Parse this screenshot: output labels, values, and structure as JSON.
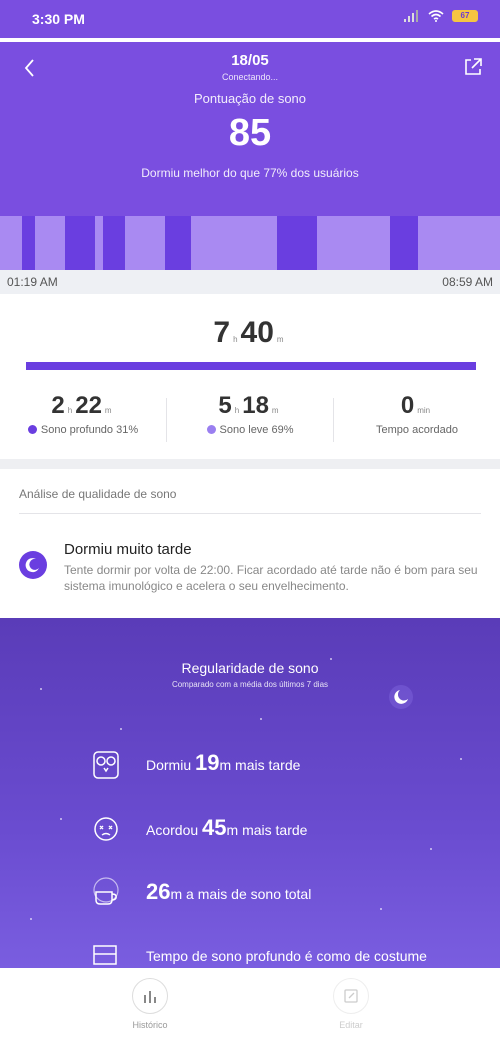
{
  "status_bar": {
    "time": "3:30 PM",
    "battery": "67"
  },
  "header": {
    "date": "18/05",
    "connecting": "Conectando...",
    "score_label": "Pontuação de sono",
    "score": "85",
    "score_desc": "Dormiu melhor do que 77% dos usuários"
  },
  "timeline": {
    "start": "01:19 AM",
    "end": "08:59 AM"
  },
  "total": {
    "hours": "7",
    "hours_unit": "h",
    "minutes": "40",
    "minutes_unit": "m"
  },
  "stats": [
    {
      "hours": "2",
      "h_unit": "h",
      "minutes": "22",
      "m_unit": "m",
      "label": "Sono profundo 31%",
      "color": "#6a3ee0"
    },
    {
      "hours": "5",
      "h_unit": "h",
      "minutes": "18",
      "m_unit": "m",
      "label": "Sono leve 69%",
      "color": "#9a7ff0"
    },
    {
      "minutes": "0",
      "m_unit": "min",
      "label": "Tempo acordado"
    }
  ],
  "analysis": {
    "label": "Análise de qualidade de sono",
    "tip_title": "Dormiu muito tarde",
    "tip_text": "Tente dormir por volta de 22:00. Ficar acordado até tarde não é bom para seu sistema imunológico e acelera o seu envelhecimento."
  },
  "regularity": {
    "title": "Regularidade de sono",
    "subtitle": "Comparado com a média dos últimos 7 dias",
    "rows": [
      {
        "prefix": "Dormiu ",
        "value": "19",
        "suffix": "m mais tarde",
        "icon": "owl-icon"
      },
      {
        "prefix": "Acordou ",
        "value": "45",
        "suffix": "m mais tarde",
        "icon": "alarm-face-icon"
      },
      {
        "prefix": "",
        "value": "26",
        "suffix": "m a mais de sono total",
        "icon": "coffee-cup-icon"
      },
      {
        "prefix": "Tempo de sono profundo é como de costume",
        "value": "",
        "suffix": "",
        "icon": "bed-icon"
      }
    ]
  },
  "nav": {
    "history": "Histórico",
    "edit": "Editar"
  },
  "colors": {
    "accent": "#7a4ee0",
    "deep": "#6a3ee0",
    "light": "#9a7ff0"
  }
}
